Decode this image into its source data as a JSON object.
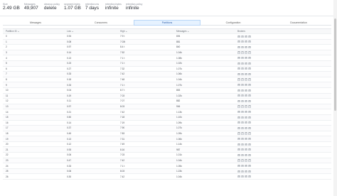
{
  "stats": [
    {
      "label": "Size",
      "value": "2.49 GB"
    },
    {
      "label": "Messages",
      "value": "49,907"
    },
    {
      "label": "cleanup.policy",
      "value": "delete"
    },
    {
      "label": "segment.bytes",
      "value": "1.07 GB"
    },
    {
      "label": "retention.ms",
      "value": "7 days"
    },
    {
      "label": "retention.bytes",
      "value": "infinite"
    },
    {
      "label": "retention.policy",
      "value": "infinite"
    }
  ],
  "tabs": [
    "Messages",
    "Consumers",
    "Partitions",
    "Configuration",
    "Documentation"
  ],
  "active_tab": 2,
  "table": {
    "headers": [
      "Partition ID",
      "Low",
      "High",
      "Messages",
      "Brokers"
    ],
    "rows": [
      [
        "0",
        "0.94",
        "7.9 t",
        "694"
      ],
      [
        "1",
        "0.08",
        "7.03t",
        "881"
      ],
      [
        "2",
        "0.97",
        "8.4 t",
        "840"
      ],
      [
        "3",
        "0.14",
        "7.52",
        "1.04k"
      ],
      [
        "4",
        "0.13",
        "7.1 t",
        "1.08k"
      ],
      [
        "5",
        "0.23",
        "7.1 t",
        "1.02k"
      ],
      [
        "6",
        "0.27",
        "7.32",
        "1.07k"
      ],
      [
        "7",
        "0.33",
        "7.42",
        "1.06k"
      ],
      [
        "8",
        "0.18",
        "7.48",
        "1.04k"
      ],
      [
        "9",
        "0.33",
        "7.1 t",
        "1.07k"
      ],
      [
        "10",
        "0.04",
        "8.7 t",
        "853"
      ],
      [
        "11",
        "0.19",
        "7.03",
        "1.02k"
      ],
      [
        "12",
        "0.11",
        "7.07",
        "882"
      ],
      [
        "13",
        "0.97",
        "8.03",
        "906"
      ],
      [
        "14",
        "0.21",
        "7.42",
        "1.13k"
      ],
      [
        "15",
        "0.50",
        "7.18",
        "1.10k"
      ],
      [
        "16",
        "0.14",
        "7.19",
        "1.09k"
      ],
      [
        "17",
        "0.37",
        "7.90",
        "1.07k"
      ],
      [
        "18",
        "0.45",
        "7.83",
        "1.09k"
      ],
      [
        "19",
        "0.13",
        "7.31",
        "1.06k"
      ],
      [
        "20",
        "0.12",
        "7.49",
        "1.14k"
      ],
      [
        "21",
        "0.93",
        "8.16",
        "987"
      ],
      [
        "22",
        "0.06",
        "7.03",
        "1.01k"
      ],
      [
        "23",
        "0.47",
        "7.42",
        "1.04k"
      ],
      [
        "24",
        "0.33",
        "7.1 t",
        "1.05k"
      ],
      [
        "25",
        "0.06",
        "8.03",
        "1.23k"
      ],
      [
        "26",
        "0.30",
        "7.42",
        "1.04k"
      ]
    ],
    "broker_buttons": [
      "0",
      "1",
      "2",
      "3"
    ]
  }
}
